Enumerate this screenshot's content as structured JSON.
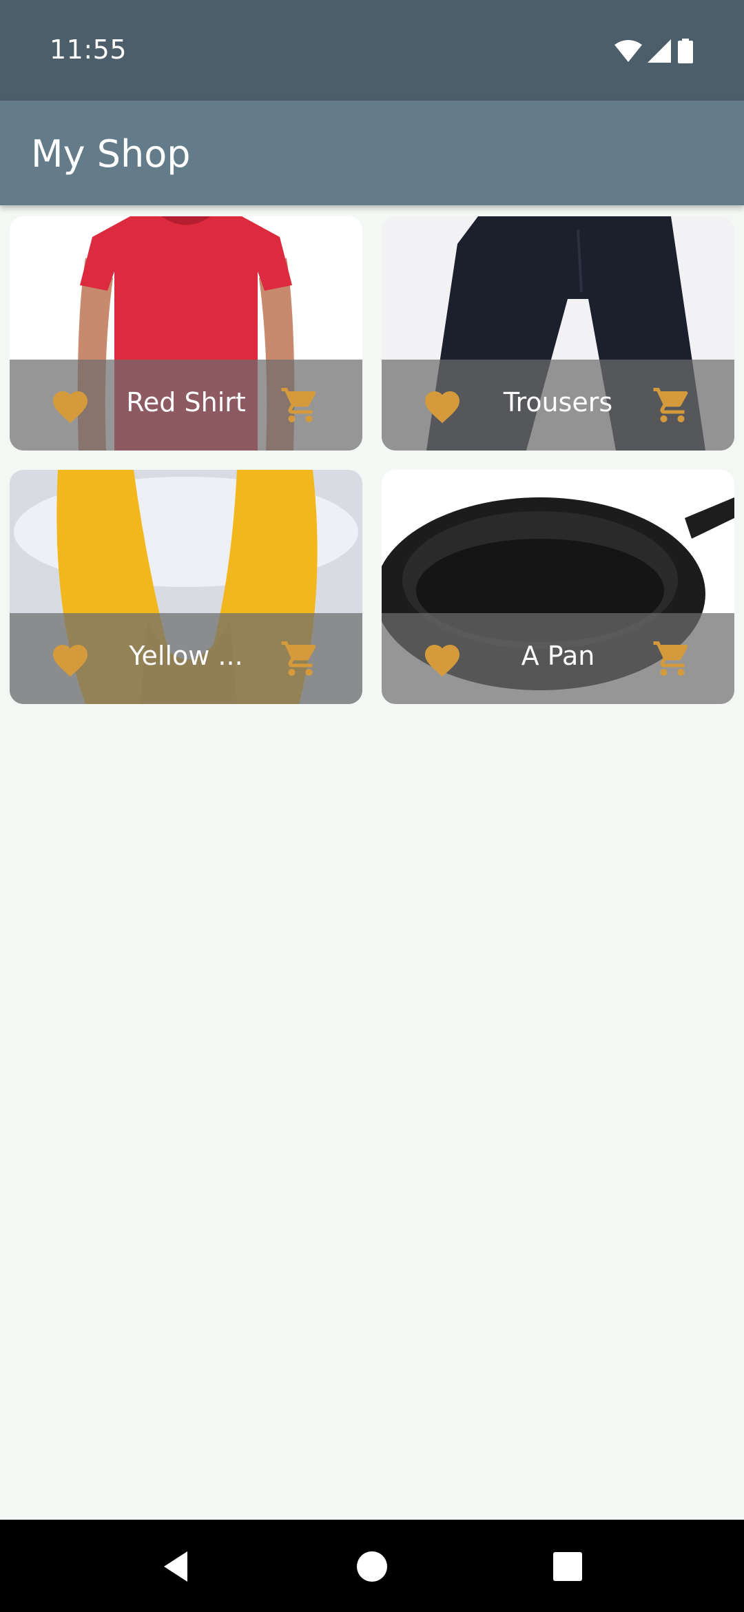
{
  "status_bar": {
    "time": "11:55",
    "icons": [
      "wifi-icon",
      "cell-signal-icon",
      "battery-icon"
    ]
  },
  "app_bar": {
    "title": "My Shop"
  },
  "colors": {
    "status_bar": "#4b5e6a",
    "app_bar": "#647c8a",
    "accent": "#d49a3c",
    "background": "#f4f8f4",
    "footer_overlay": "rgba(110,110,110,0.72)"
  },
  "products": [
    {
      "title": "Red Shirt",
      "image": "red-shirt-image",
      "favorite_icon": "heart-icon",
      "cart_icon": "cart-icon"
    },
    {
      "title": "Trousers",
      "image": "trousers-image",
      "favorite_icon": "heart-icon",
      "cart_icon": "cart-icon"
    },
    {
      "title": "Yellow ...",
      "image": "yellow-scarf-image",
      "favorite_icon": "heart-icon",
      "cart_icon": "cart-icon"
    },
    {
      "title": "A Pan",
      "image": "pan-image",
      "favorite_icon": "heart-icon",
      "cart_icon": "cart-icon"
    }
  ],
  "nav_bar": {
    "buttons": [
      "back-icon",
      "home-icon",
      "recents-icon"
    ]
  }
}
